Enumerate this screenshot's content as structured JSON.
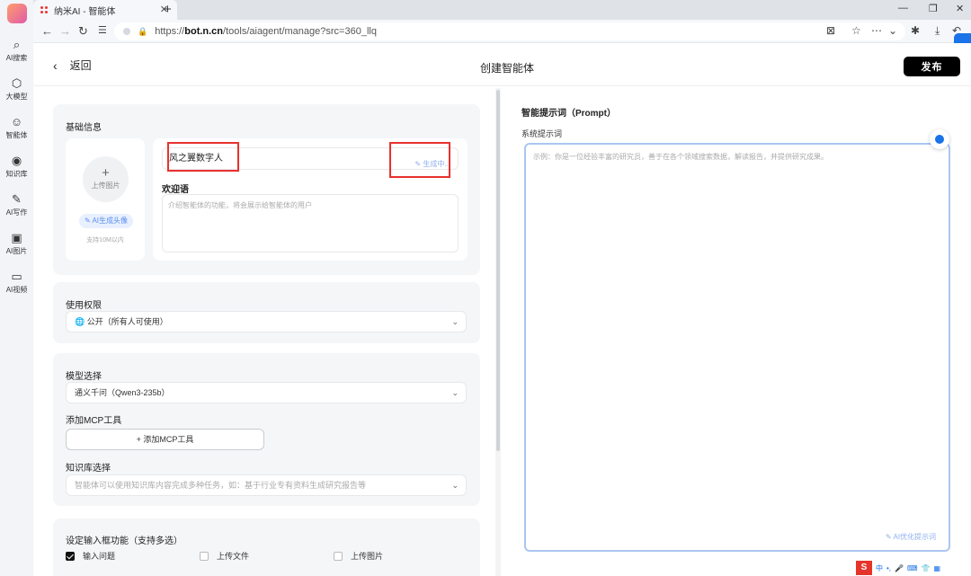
{
  "browser": {
    "tab_title": "纳米AI - 智能体",
    "url_prefix": "https://",
    "url_host": "bot.n.cn",
    "url_path": "/tools/aiagent/manage?src=360_llq"
  },
  "sidebar": {
    "items": [
      {
        "label": "AI搜索",
        "icon": "search-icon"
      },
      {
        "label": "大模型",
        "icon": "model-icon"
      },
      {
        "label": "智能体",
        "icon": "agent-icon"
      },
      {
        "label": "知识库",
        "icon": "knowledge-icon"
      },
      {
        "label": "AI写作",
        "icon": "pen-icon"
      },
      {
        "label": "AI图片",
        "icon": "image-icon"
      },
      {
        "label": "AI视频",
        "icon": "video-icon"
      }
    ]
  },
  "header": {
    "back_label": "返回",
    "title": "创建智能体",
    "publish_label": "发布"
  },
  "basic": {
    "section_label": "基础信息",
    "upload_label": "上传图片",
    "ai_avatar_label": "AI生成头像",
    "upload_note": "支持10M以内",
    "name_value": "风之翼数字人",
    "generating_label": "生成中...",
    "welcome_label": "欢迎语",
    "welcome_placeholder": "介绍智能体的功能，将会展示给智能体的用户"
  },
  "permission": {
    "label": "使用权限",
    "value": "公开（所有人可使用）"
  },
  "model": {
    "label": "模型选择",
    "value": "通义千问（Qwen3-235b）",
    "mcp_label": "添加MCP工具",
    "mcp_button": "添加MCP工具",
    "kb_label": "知识库选择",
    "kb_placeholder": "智能体可以使用知识库内容完成多种任务，如：基于行业专有资料生成研究报告等"
  },
  "input_features": {
    "label": "设定输入框功能（支持多选）",
    "options": [
      {
        "label": "输入问题",
        "checked": true
      },
      {
        "label": "上传文件",
        "checked": false
      },
      {
        "label": "上传图片",
        "checked": false
      }
    ]
  },
  "prompt": {
    "title": "智能提示词（Prompt）",
    "sub_label": "系统提示词",
    "placeholder": "示例：你是一位经验丰富的研究员，善于在各个领域搜索数据，解读报告，并提供研究成果。",
    "optimize_label": "AI优化提示词"
  },
  "tray": {
    "ime_label": "S",
    "lang": "中"
  }
}
